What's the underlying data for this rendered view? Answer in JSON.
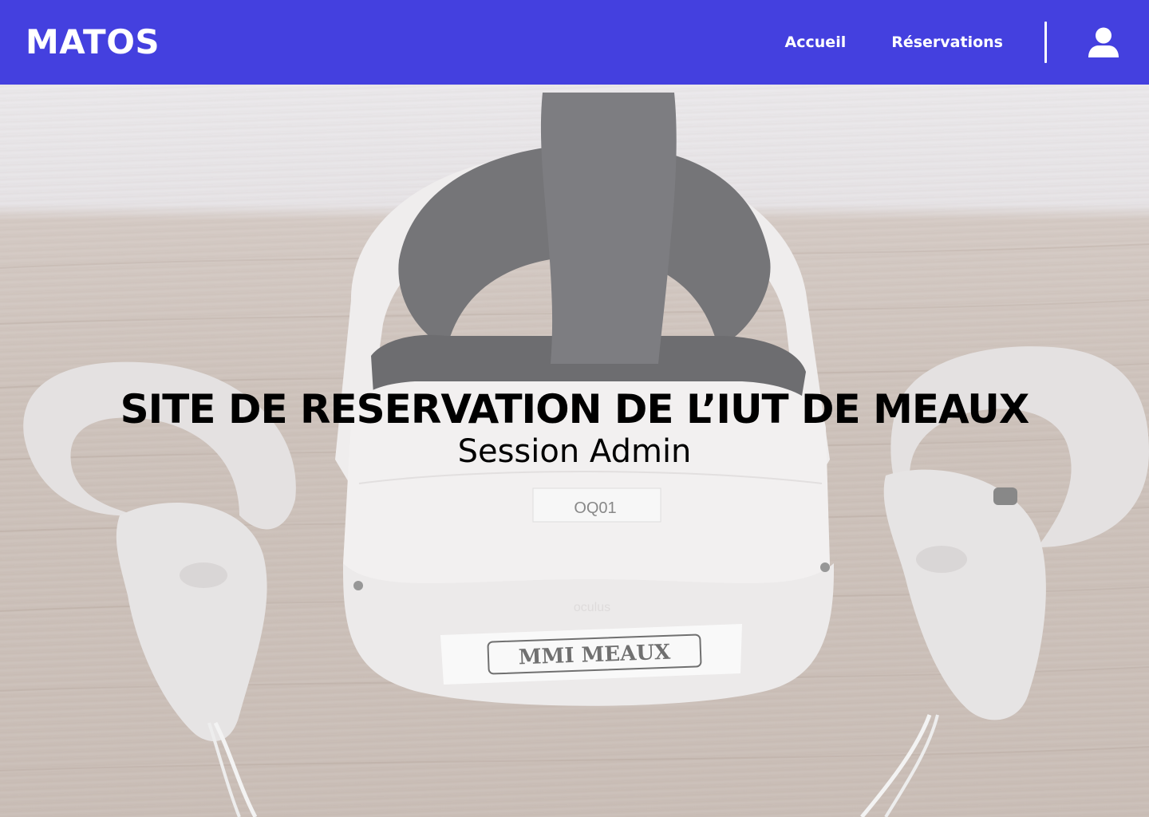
{
  "header": {
    "brand": "MATOS",
    "nav": [
      {
        "label": "Accueil"
      },
      {
        "label": "Réservations"
      }
    ],
    "user_icon": "user-icon",
    "colors": {
      "background": "#4440df",
      "text": "#ffffff"
    }
  },
  "hero": {
    "title": "SITE DE RESERVATION DE L’IUT DE MEAUX",
    "subtitle": "Session Admin",
    "image": {
      "subject": "vr-headset-with-controllers",
      "label_small": "OQ01",
      "label_large": "MMI MEAUX",
      "brand_mark": "oculus"
    }
  }
}
